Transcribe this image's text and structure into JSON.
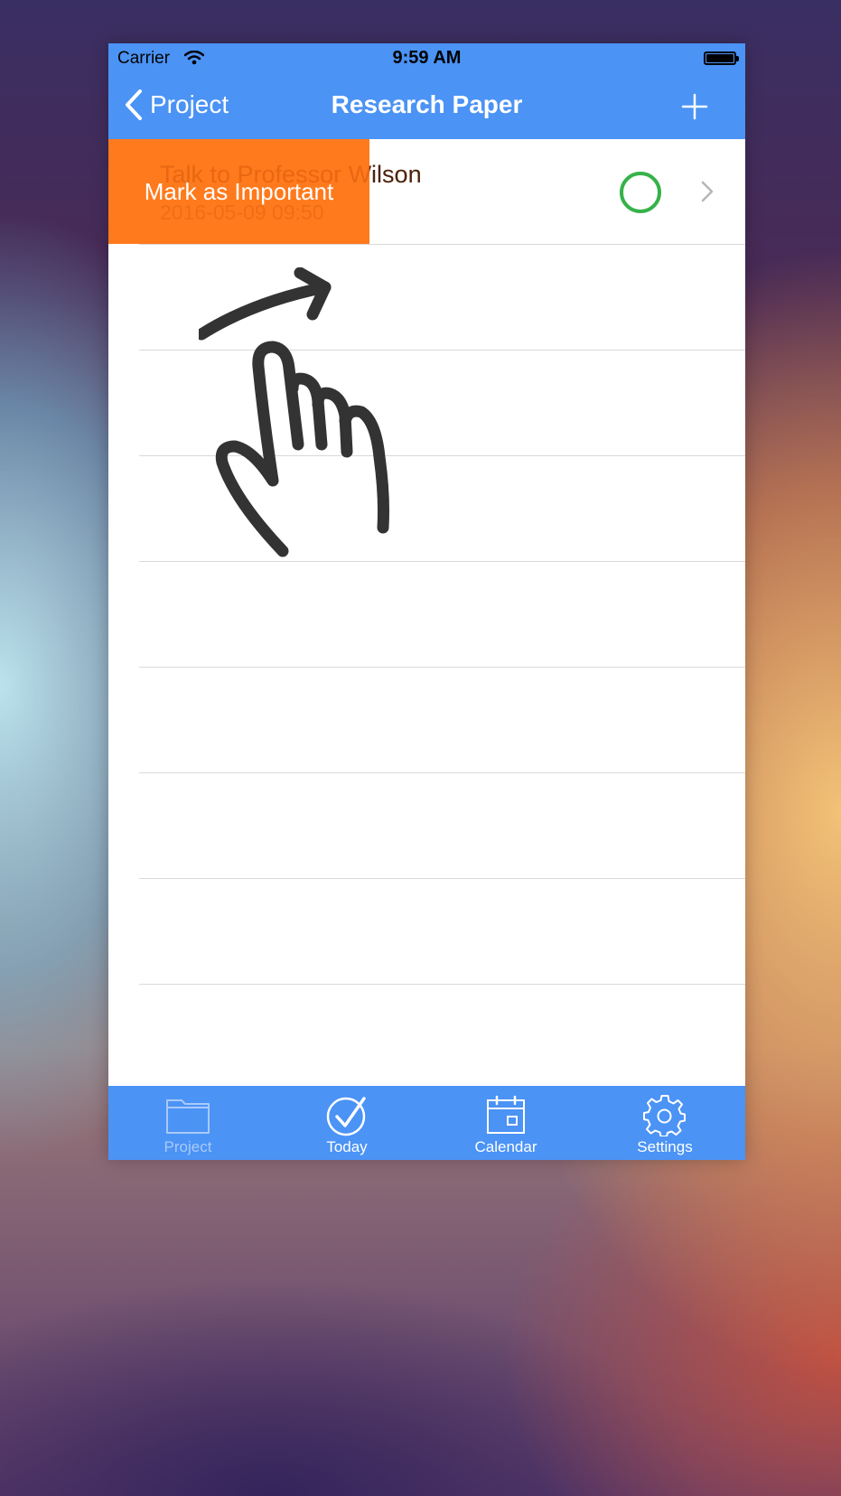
{
  "status_bar": {
    "carrier": "Carrier",
    "time": "9:59 AM"
  },
  "nav": {
    "back_label": "Project",
    "title": "Research Paper"
  },
  "task": {
    "title": "Talk to Professor Wilson",
    "date": "2016-05-09 09:50",
    "swipe_action_label": "Mark as Important"
  },
  "tabs": [
    {
      "label": "Project",
      "icon": "folder-icon",
      "active": false
    },
    {
      "label": "Today",
      "icon": "check-circle-icon",
      "active": true
    },
    {
      "label": "Calendar",
      "icon": "calendar-icon",
      "active": true
    },
    {
      "label": "Settings",
      "icon": "gear-icon",
      "active": true
    }
  ],
  "colors": {
    "bar": "#4b93f5",
    "swipe_action": "#ff7a1c",
    "status_circle": "#36b24a"
  }
}
